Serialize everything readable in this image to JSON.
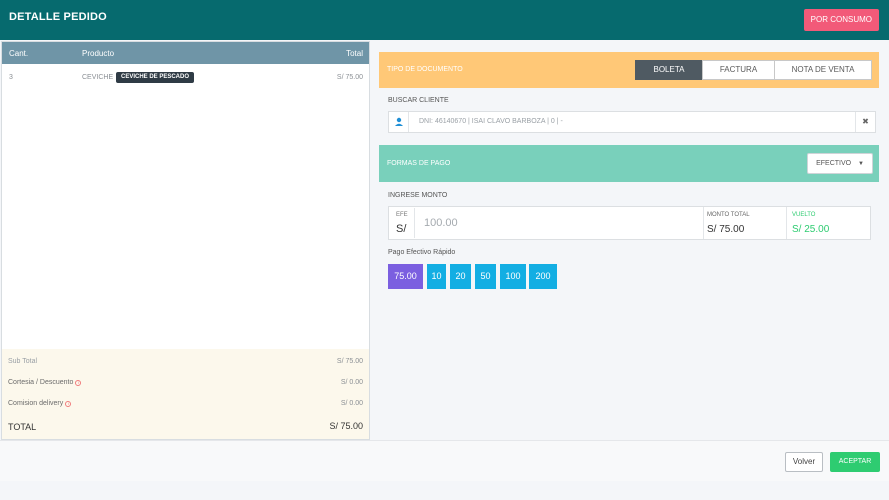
{
  "header": {
    "title": "DETALLE PEDIDO",
    "consumo_label": "POR CONSUMO"
  },
  "order_table": {
    "columns": {
      "qty": "Cant.",
      "product": "Producto",
      "total": "Total"
    },
    "rows": [
      {
        "qty": "3",
        "product": "CEVICHE",
        "badge": "CEVICHE DE PESCADO",
        "total": "S/ 75.00"
      }
    ]
  },
  "totals": {
    "subtotal_label": "Sub Total",
    "subtotal_value": "S/ 75.00",
    "cortesia_label": "Cortesia / Descuento",
    "cortesia_value": "S/ 0.00",
    "delivery_label": "Comision delivery",
    "delivery_value": "S/ 0.00",
    "total_label": "TOTAL",
    "total_value": "S/ 75.00"
  },
  "documento": {
    "label": "TIPO DE DOCUMENTO",
    "options": [
      "BOLETA",
      "FACTURA",
      "NOTA DE VENTA"
    ],
    "selected": "BOLETA"
  },
  "cliente": {
    "label": "BUSCAR CLIENTE",
    "value": "DNI: 46140670 | ISAI CLAVO BARBOZA | 0 | -"
  },
  "pago": {
    "label": "FORMAS DE PAGO",
    "method": "EFECTIVO",
    "ingrese_label": "INGRESE MONTO",
    "efe_label": "EFE",
    "currency": "S/",
    "amount_placeholder": "100.00",
    "monto_total_label": "MONTO TOTAL",
    "monto_total_value": "S/ 75.00",
    "vuelto_label": "VUELTO",
    "vuelto_value": "S/ 25.00"
  },
  "rapido": {
    "label": "Pago Efectivo Rápido",
    "amounts": [
      "75.00",
      "10",
      "20",
      "50",
      "100",
      "200"
    ]
  },
  "footer": {
    "volver_label": "Volver",
    "aceptar_label": "ACEPTAR"
  },
  "colors": {
    "header": "#066a6e",
    "consumo": "#f25a79",
    "table_head": "#6f95a7",
    "tipo_bar": "#ffc877",
    "pago_bar": "#79d0bb",
    "quick_primary": "#7b5fe0",
    "quick_secondary": "#13aee3",
    "vuelto": "#2ecc71",
    "aceptar": "#2ecc71"
  }
}
